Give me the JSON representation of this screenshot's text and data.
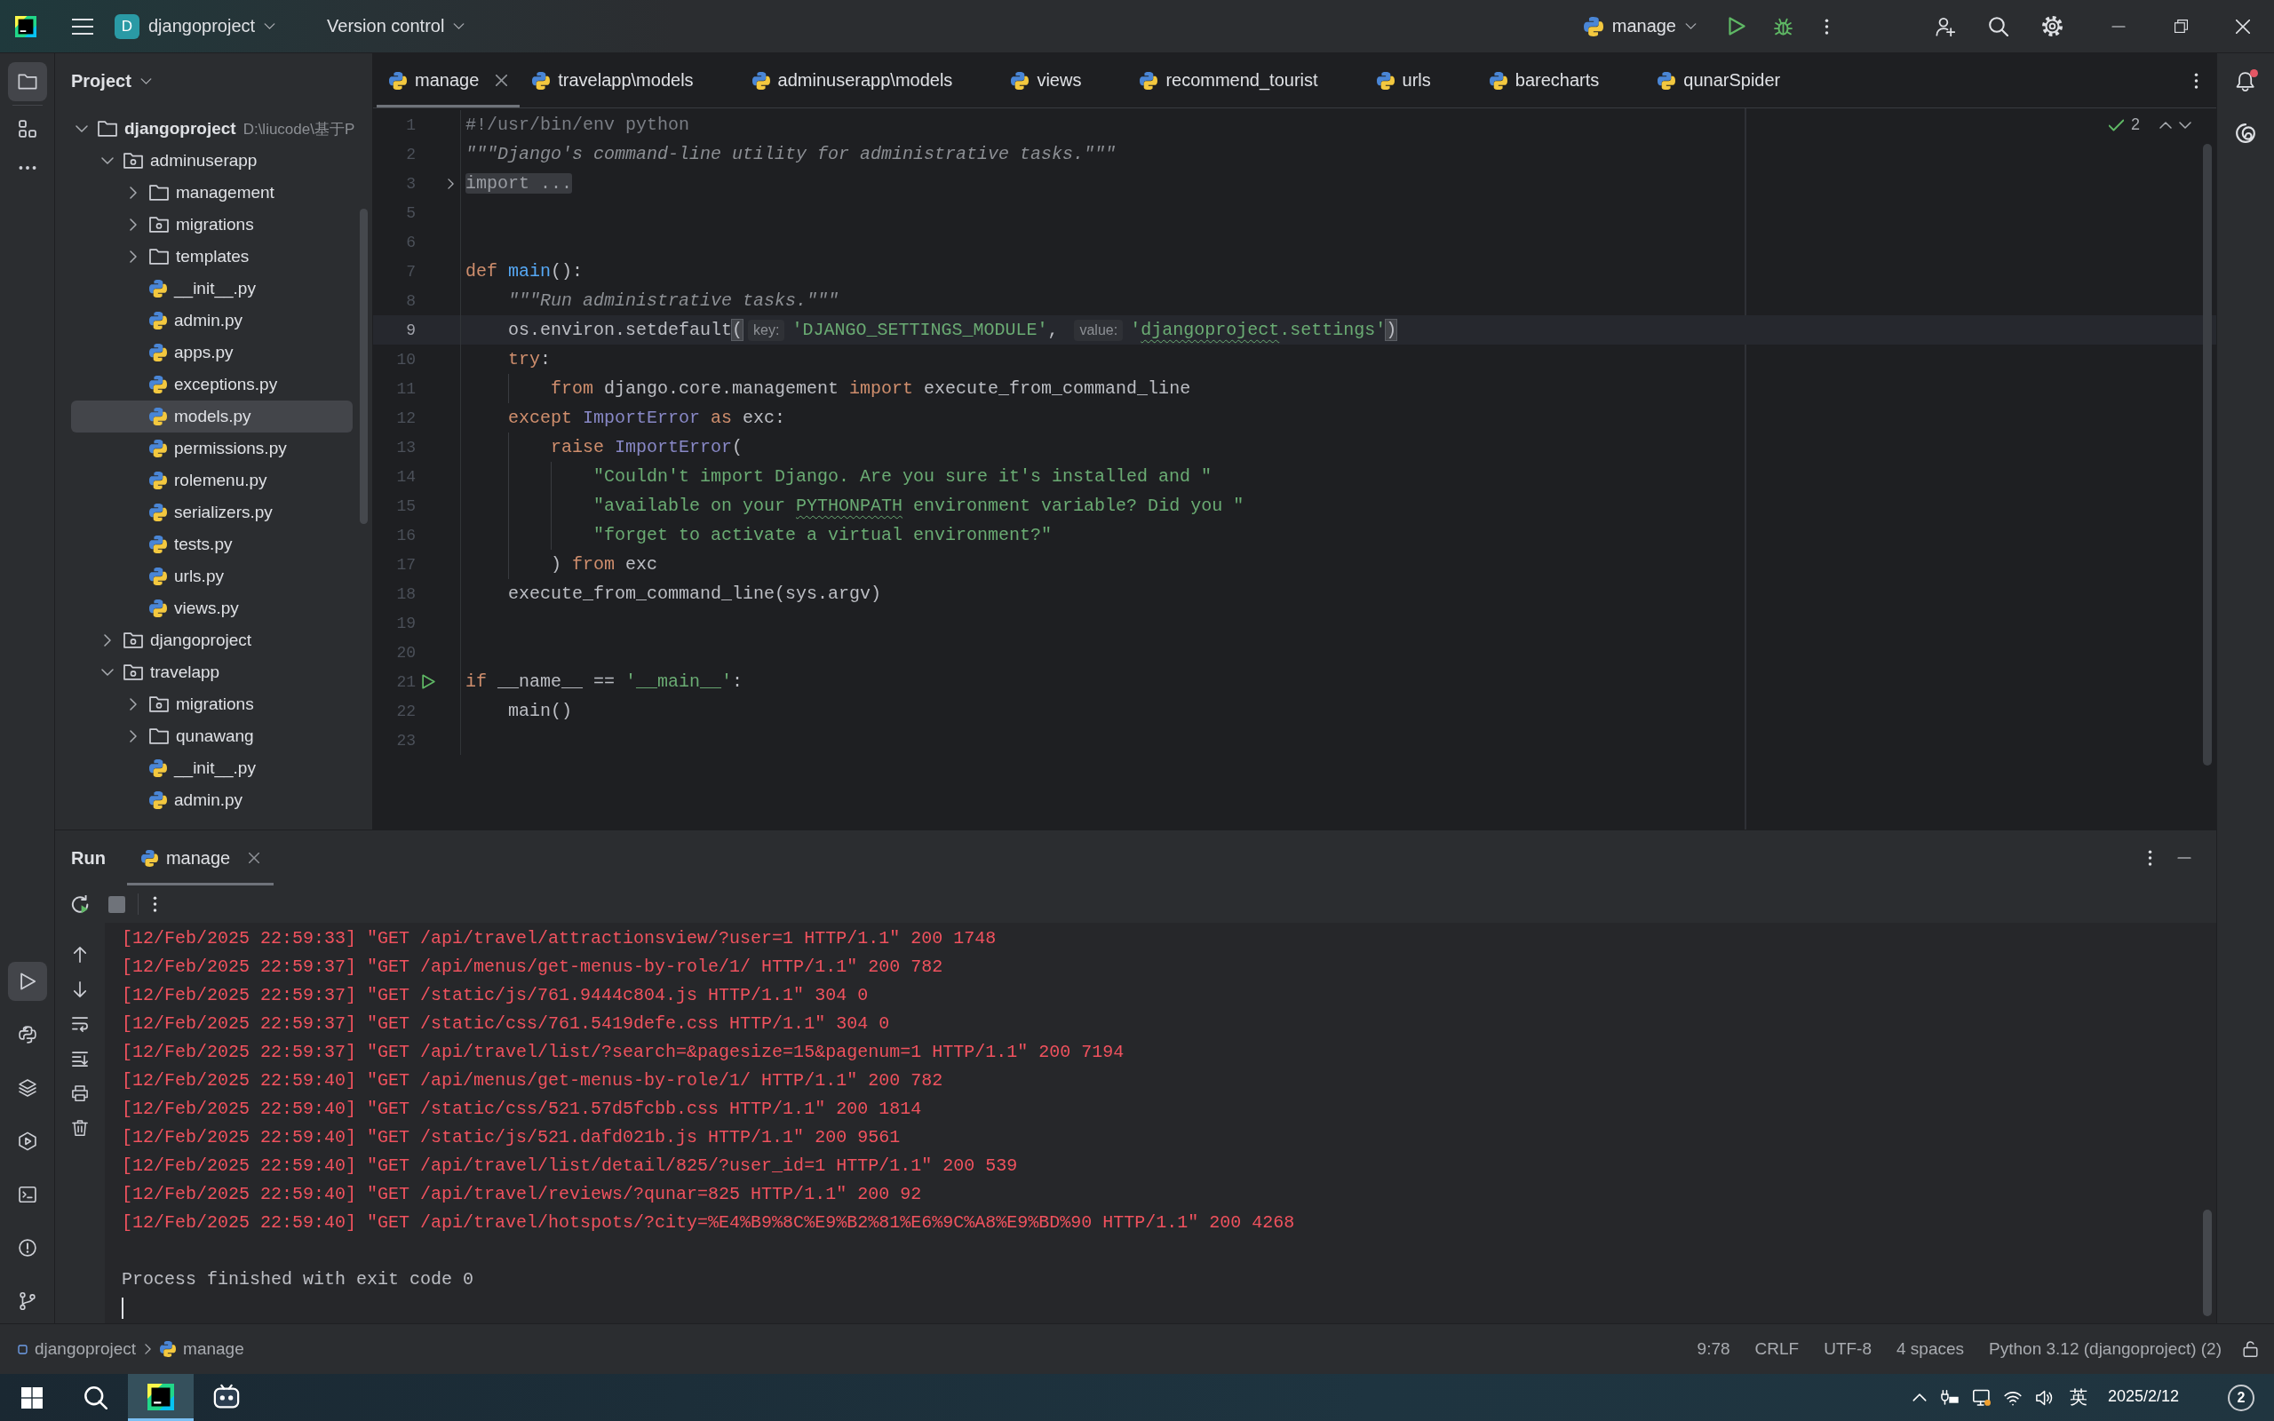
{
  "title_bar": {
    "project_initial": "D",
    "project": "djangoproject",
    "vcs": "Version control",
    "run_config": "manage"
  },
  "left_toolbar": {
    "top": [
      {
        "kind": "project",
        "selected": true
      },
      {
        "kind": "structure",
        "selected": false
      },
      {
        "kind": "more",
        "selected": false
      }
    ],
    "bottom": [
      {
        "kind": "run",
        "selected": true
      },
      {
        "kind": "python-console",
        "selected": false
      },
      {
        "kind": "python-packages",
        "selected": false
      },
      {
        "kind": "services",
        "selected": false
      },
      {
        "kind": "terminal",
        "selected": false
      },
      {
        "kind": "problems",
        "selected": false
      },
      {
        "kind": "git",
        "selected": false
      }
    ]
  },
  "project_panel": {
    "title": "Project",
    "tree": [
      {
        "name": "djangoproject",
        "kind": "root",
        "path": "D:\\liucode\\基于P",
        "expanded": true,
        "selected": false,
        "children": [
          {
            "name": "adminuserapp",
            "kind": "package",
            "expanded": true,
            "selected": false,
            "children": [
              {
                "name": "management",
                "kind": "folder",
                "expanded": false,
                "selected": false
              },
              {
                "name": "migrations",
                "kind": "package",
                "expanded": false,
                "selected": false
              },
              {
                "name": "templates",
                "kind": "folder",
                "expanded": false,
                "selected": false
              },
              {
                "name": "__init__.py",
                "kind": "file",
                "selected": false
              },
              {
                "name": "admin.py",
                "kind": "file",
                "selected": false
              },
              {
                "name": "apps.py",
                "kind": "file",
                "selected": false
              },
              {
                "name": "exceptions.py",
                "kind": "file",
                "selected": false
              },
              {
                "name": "models.py",
                "kind": "file",
                "selected": true
              },
              {
                "name": "permissions.py",
                "kind": "file",
                "selected": false
              },
              {
                "name": "rolemenu.py",
                "kind": "file",
                "selected": false
              },
              {
                "name": "serializers.py",
                "kind": "file",
                "selected": false
              },
              {
                "name": "tests.py",
                "kind": "file",
                "selected": false
              },
              {
                "name": "urls.py",
                "kind": "file",
                "selected": false
              },
              {
                "name": "views.py",
                "kind": "file",
                "selected": false
              }
            ]
          },
          {
            "name": "djangoproject",
            "kind": "package",
            "expanded": false,
            "selected": false
          },
          {
            "name": "travelapp",
            "kind": "package",
            "expanded": true,
            "selected": false,
            "children": [
              {
                "name": "migrations",
                "kind": "package",
                "expanded": false,
                "selected": false
              },
              {
                "name": "qunawang",
                "kind": "folder",
                "expanded": false,
                "selected": false
              },
              {
                "name": "__init__.py",
                "kind": "file",
                "selected": false
              },
              {
                "name": "admin.py",
                "kind": "file",
                "selected": false
              }
            ]
          }
        ]
      }
    ]
  },
  "editor": {
    "tabs": [
      {
        "label": "manage",
        "selected": true
      },
      {
        "label": "travelapp\\models",
        "selected": false
      },
      {
        "label": "adminuserapp\\models",
        "selected": false
      },
      {
        "label": "views",
        "selected": false
      },
      {
        "label": "recommend_tourist",
        "selected": false
      },
      {
        "label": "urls",
        "selected": false
      },
      {
        "label": "barecharts",
        "selected": false
      },
      {
        "label": "qunarSpider",
        "selected": false
      }
    ],
    "inspections": "2",
    "lines": [
      {
        "number": "1",
        "kind": "code",
        "current": false,
        "tokens": [
          {
            "kind": "comment",
            "text": "#!/usr/bin/env python"
          }
        ]
      },
      {
        "number": "2",
        "kind": "code",
        "current": false,
        "tokens": [
          {
            "kind": "docstring",
            "text": "\"\"\"Django's command-line utility for administrative tasks.\"\"\""
          }
        ]
      },
      {
        "number": "3",
        "kind": "fold",
        "current": false,
        "tokens": [
          {
            "kind": "folded",
            "text": "import ..."
          }
        ]
      },
      {
        "number": "5",
        "kind": "code",
        "current": false
      },
      {
        "number": "6",
        "kind": "code",
        "current": false
      },
      {
        "number": "7",
        "kind": "code",
        "current": false,
        "tokens": [
          {
            "kind": "keyword",
            "text": "def "
          },
          {
            "kind": "function",
            "text": "main"
          },
          {
            "kind": "plain",
            "text": "():"
          }
        ]
      },
      {
        "number": "8",
        "kind": "code",
        "current": false,
        "tokens": [
          {
            "kind": "docstring",
            "text": "    \"\"\"Run administrative tasks.\"\"\""
          }
        ]
      },
      {
        "number": "9",
        "kind": "code",
        "current": true,
        "tokens": [
          {
            "kind": "plain",
            "text": "    os.environ.setdefault"
          },
          {
            "kind": "brace",
            "text": "("
          },
          {
            "kind": "hint",
            "text": "key:"
          },
          {
            "kind": "string",
            "text": "'DJANGO_SETTINGS_MODULE'"
          },
          {
            "kind": "plain",
            "text": ", "
          },
          {
            "kind": "hint",
            "text": "value:"
          },
          {
            "kind": "string",
            "text": "'"
          },
          {
            "kind": "typo",
            "text": "djangoproject"
          },
          {
            "kind": "string",
            "text": ".settings'"
          },
          {
            "kind": "brace",
            "text": ")"
          }
        ]
      },
      {
        "number": "10",
        "kind": "code",
        "current": false,
        "tokens": [
          {
            "kind": "keyword",
            "text": "    try"
          },
          {
            "kind": "plain",
            "text": ":"
          }
        ]
      },
      {
        "number": "11",
        "kind": "code",
        "current": false,
        "tokens": [
          {
            "kind": "keyword",
            "text": "        from"
          },
          {
            "kind": "plain",
            "text": " django.core.management "
          },
          {
            "kind": "keyword",
            "text": "import"
          },
          {
            "kind": "plain",
            "text": " execute_from_command_line"
          }
        ]
      },
      {
        "number": "12",
        "kind": "code",
        "current": false,
        "tokens": [
          {
            "kind": "keyword",
            "text": "    except "
          },
          {
            "kind": "builtin",
            "text": "ImportError"
          },
          {
            "kind": "keyword",
            "text": " as"
          },
          {
            "kind": "plain",
            "text": " exc:"
          }
        ]
      },
      {
        "number": "13",
        "kind": "code",
        "current": false,
        "tokens": [
          {
            "kind": "keyword",
            "text": "        raise "
          },
          {
            "kind": "builtin",
            "text": "ImportError"
          },
          {
            "kind": "plain",
            "text": "("
          }
        ]
      },
      {
        "number": "14",
        "kind": "code",
        "current": false,
        "tokens": [
          {
            "kind": "string",
            "text": "            \"Couldn't import Django. Are you sure it's installed and \""
          }
        ]
      },
      {
        "number": "15",
        "kind": "code",
        "current": false,
        "tokens": [
          {
            "kind": "string",
            "text": "            \"available on your "
          },
          {
            "kind": "typo",
            "text": "PYTHONPATH"
          },
          {
            "kind": "string",
            "text": " environment variable? Did you \""
          }
        ]
      },
      {
        "number": "16",
        "kind": "code",
        "current": false,
        "tokens": [
          {
            "kind": "string",
            "text": "            \"forget to activate a virtual environment?\""
          }
        ]
      },
      {
        "number": "17",
        "kind": "code",
        "current": false,
        "tokens": [
          {
            "kind": "plain",
            "text": "        ) "
          },
          {
            "kind": "keyword",
            "text": "from"
          },
          {
            "kind": "plain",
            "text": " exc"
          }
        ]
      },
      {
        "number": "18",
        "kind": "code",
        "current": false,
        "tokens": [
          {
            "kind": "plain",
            "text": "    execute_from_command_line(sys.argv)"
          }
        ]
      },
      {
        "number": "19",
        "kind": "code",
        "current": false
      },
      {
        "number": "20",
        "kind": "code",
        "current": false
      },
      {
        "number": "21",
        "kind": "run",
        "current": false,
        "tokens": [
          {
            "kind": "keyword",
            "text": "if"
          },
          {
            "kind": "plain",
            "text": " __name__ == "
          },
          {
            "kind": "string",
            "text": "'__main__'"
          },
          {
            "kind": "plain",
            "text": ":"
          }
        ]
      },
      {
        "number": "22",
        "kind": "code",
        "current": false,
        "tokens": [
          {
            "kind": "plain",
            "text": "    main()"
          }
        ]
      },
      {
        "number": "23",
        "kind": "code",
        "current": false
      }
    ]
  },
  "run_panel": {
    "title": "Run",
    "tabs": [
      {
        "label": "manage",
        "selected": true
      }
    ],
    "stop": {
      "disabled": true
    },
    "console": [
      {
        "kind": "error",
        "text": "[12/Feb/2025 22:59:33] \"GET /api/travel/attractionsview/?user=1 HTTP/1.1\" 200 1748"
      },
      {
        "kind": "error",
        "text": "[12/Feb/2025 22:59:37] \"GET /api/menus/get-menus-by-role/1/ HTTP/1.1\" 200 782"
      },
      {
        "kind": "error",
        "text": "[12/Feb/2025 22:59:37] \"GET /static/js/761.9444c804.js HTTP/1.1\" 304 0"
      },
      {
        "kind": "error",
        "text": "[12/Feb/2025 22:59:37] \"GET /static/css/761.5419defe.css HTTP/1.1\" 304 0"
      },
      {
        "kind": "error",
        "text": "[12/Feb/2025 22:59:37] \"GET /api/travel/list/?search=&pagesize=15&pagenum=1 HTTP/1.1\" 200 7194"
      },
      {
        "kind": "error",
        "text": "[12/Feb/2025 22:59:40] \"GET /api/menus/get-menus-by-role/1/ HTTP/1.1\" 200 782"
      },
      {
        "kind": "error",
        "text": "[12/Feb/2025 22:59:40] \"GET /static/css/521.57d5fcbb.css HTTP/1.1\" 200 1814"
      },
      {
        "kind": "error",
        "text": "[12/Feb/2025 22:59:40] \"GET /static/js/521.dafd021b.js HTTP/1.1\" 200 9561"
      },
      {
        "kind": "error",
        "text": "[12/Feb/2025 22:59:40] \"GET /api/travel/list/detail/825/?user_id=1 HTTP/1.1\" 200 539"
      },
      {
        "kind": "error",
        "text": "[12/Feb/2025 22:59:40] \"GET /api/travel/reviews/?qunar=825 HTTP/1.1\" 200 92"
      },
      {
        "kind": "error",
        "text": "[12/Feb/2025 22:59:40] \"GET /api/travel/hotspots/?city=%E4%B9%8C%E9%B2%81%E6%9C%A8%E9%BD%90 HTTP/1.1\" 200 4268"
      },
      {
        "kind": "exit",
        "text": "Process finished with exit code 0"
      }
    ]
  },
  "right_toolbar": {
    "unread": true
  },
  "status_bar": {
    "breadcrumbs": [
      {
        "kind": "project",
        "label": "djangoproject"
      },
      {
        "kind": "file",
        "label": "manage"
      }
    ],
    "items": [
      "9:78",
      "CRLF",
      "UTF-8",
      "4 spaces",
      "Python 3.12 (djangoproject) (2)"
    ]
  },
  "taskbar": {
    "apps": [
      {
        "kind": "pycharm",
        "selected": true
      },
      {
        "kind": "app",
        "selected": false
      }
    ],
    "tray": {
      "ime": "英",
      "date": "2025/2/12",
      "notifications": "2"
    }
  }
}
